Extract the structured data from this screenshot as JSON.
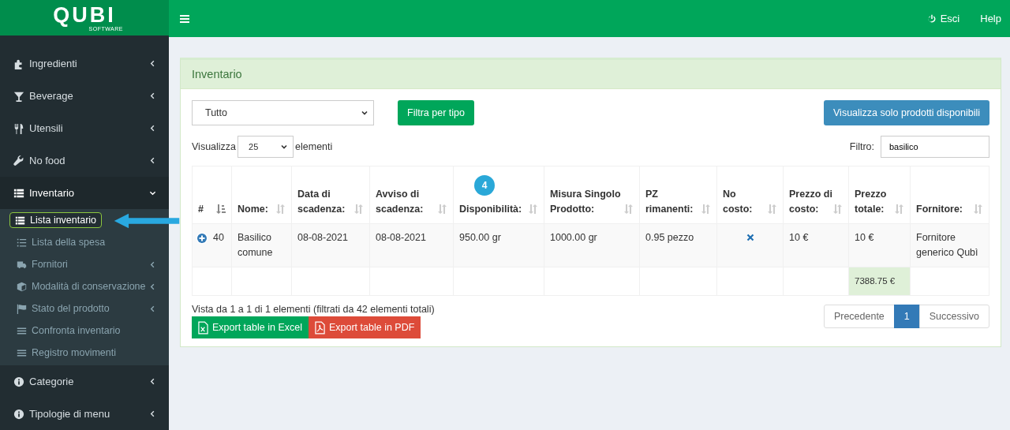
{
  "logo": {
    "name": "QUBI",
    "tagline": "SOFTWARE"
  },
  "topbar": {
    "actions": [
      {
        "label": "Esci",
        "kind": "power"
      },
      {
        "label": "Help",
        "kind": "plain"
      }
    ]
  },
  "sidebar": {
    "items": [
      {
        "label": "Ingredienti",
        "kind": "puzzle",
        "expanded": false
      },
      {
        "label": "Beverage",
        "kind": "glass",
        "expanded": false
      },
      {
        "label": "Utensili",
        "kind": "utensils",
        "expanded": false
      },
      {
        "label": "No food",
        "kind": "wrench",
        "expanded": false
      },
      {
        "label": "Inventario",
        "kind": "list",
        "expanded": true,
        "children": [
          {
            "label": "Lista inventario",
            "kind": "list",
            "selected": true,
            "submenu": false,
            "annotated": true
          },
          {
            "label": "Lista della spesa",
            "kind": "numlist",
            "selected": false,
            "submenu": false,
            "annotated": false
          },
          {
            "label": "Fornitori",
            "kind": "truck",
            "selected": false,
            "submenu": true,
            "annotated": false
          },
          {
            "label": "Modalità di conservazione",
            "kind": "cube",
            "selected": false,
            "submenu": true,
            "annotated": false
          },
          {
            "label": "Stato del prodotto",
            "kind": "flag",
            "selected": false,
            "submenu": true,
            "annotated": false
          },
          {
            "label": "Confronta inventario",
            "kind": "bars",
            "selected": false,
            "submenu": false,
            "annotated": false
          },
          {
            "label": "Registro movimenti",
            "kind": "bars",
            "selected": false,
            "submenu": false,
            "annotated": false
          }
        ]
      },
      {
        "label": "Categorie",
        "kind": "info",
        "expanded": false
      },
      {
        "label": "Tipologie di menu",
        "kind": "info",
        "expanded": false
      }
    ]
  },
  "box": {
    "title": "Inventario",
    "type_select": {
      "value": "Tutto"
    },
    "filter_button": "Filtra per tipo",
    "available_button": "Visualizza solo prodotti disponibili",
    "length": {
      "before": "Visualizza",
      "value": "25",
      "after": "elementi"
    },
    "search": {
      "label": "Filtro:",
      "value": "basilico"
    },
    "table": {
      "columns": [
        {
          "label": "#",
          "sorted": true
        },
        {
          "label": "Nome:",
          "sorted": false
        },
        {
          "label": "Data di scadenza:",
          "sorted": false
        },
        {
          "label": "Avviso di scadenza:",
          "sorted": false
        },
        {
          "label": "Disponibilità:",
          "sorted": false,
          "badge": "4"
        },
        {
          "label": "Misura Singolo Prodotto:",
          "sorted": false
        },
        {
          "label": "PZ rimanenti:",
          "sorted": false
        },
        {
          "label": "No costo:",
          "sorted": false
        },
        {
          "label": "Prezzo di costo:",
          "sorted": false
        },
        {
          "label": "Prezzo totale:",
          "sorted": false
        },
        {
          "label": "Fornitore:",
          "sorted": false
        }
      ],
      "rows": [
        {
          "id": "40",
          "name": "Basilico comune",
          "expiry": "08-08-2021",
          "warning": "08-08-2021",
          "available": "950.00 gr",
          "unit_size": "1000.00 gr",
          "pieces": "0.95 pezzo",
          "no_cost": false,
          "cost_price": "10 €",
          "total_price": "10 €",
          "supplier": "Fornitore generico Qubì"
        }
      ],
      "total": "7388.75 €"
    },
    "info": "Vista da 1 a 1 di 1 elementi (filtrati da 42 elementi totali)",
    "exports": [
      {
        "label": "Export table in Excel",
        "kind": "excel"
      },
      {
        "label": "Export table in PDF",
        "kind": "pdf"
      }
    ],
    "pagination": [
      {
        "label": "Precedente",
        "selected": false
      },
      {
        "label": "1",
        "selected": true
      },
      {
        "label": "Successivo",
        "selected": false
      }
    ]
  }
}
